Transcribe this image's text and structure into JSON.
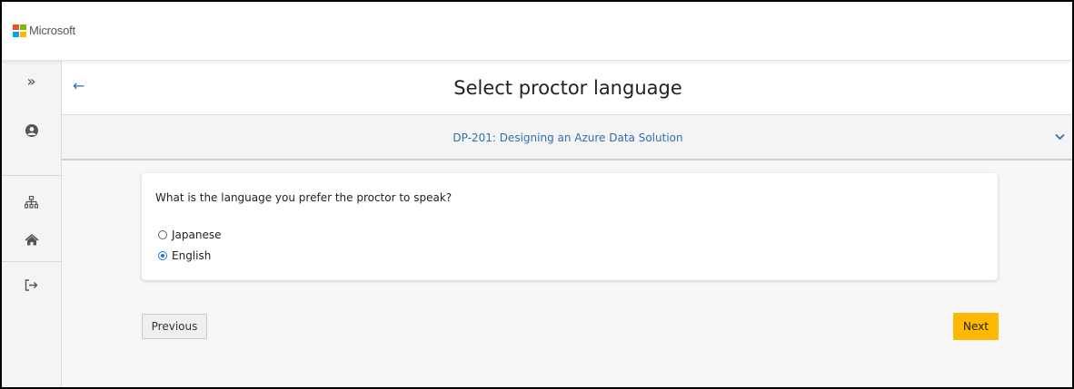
{
  "brand": {
    "name": "Microsoft",
    "logo_colors": [
      "#f25022",
      "#7fba00",
      "#00a4ef",
      "#ffb900"
    ]
  },
  "sidebar": {
    "items": [
      {
        "icon": "expand-chevrons-icon",
        "glyph": "»"
      },
      {
        "icon": "user-profile-icon",
        "glyph": "●"
      },
      {
        "icon": "sitemap-icon",
        "glyph": ""
      },
      {
        "icon": "home-icon",
        "glyph": ""
      },
      {
        "icon": "sign-out-icon",
        "glyph": ""
      }
    ]
  },
  "header": {
    "back_icon": "←",
    "title": "Select proctor language"
  },
  "exam": {
    "title": "DP-201: Designing an Azure Data Solution",
    "chevron_icon": "chevron-down-icon"
  },
  "question": {
    "text": "What is the language you prefer the proctor to speak?",
    "options": [
      {
        "label": "Japanese",
        "selected": false
      },
      {
        "label": "English",
        "selected": true
      }
    ]
  },
  "buttons": {
    "previous": "Previous",
    "next": "Next"
  },
  "colors": {
    "accent_blue": "#2f6fb0",
    "next_button": "#ffb900",
    "radio_selected": "#1a73e8"
  }
}
